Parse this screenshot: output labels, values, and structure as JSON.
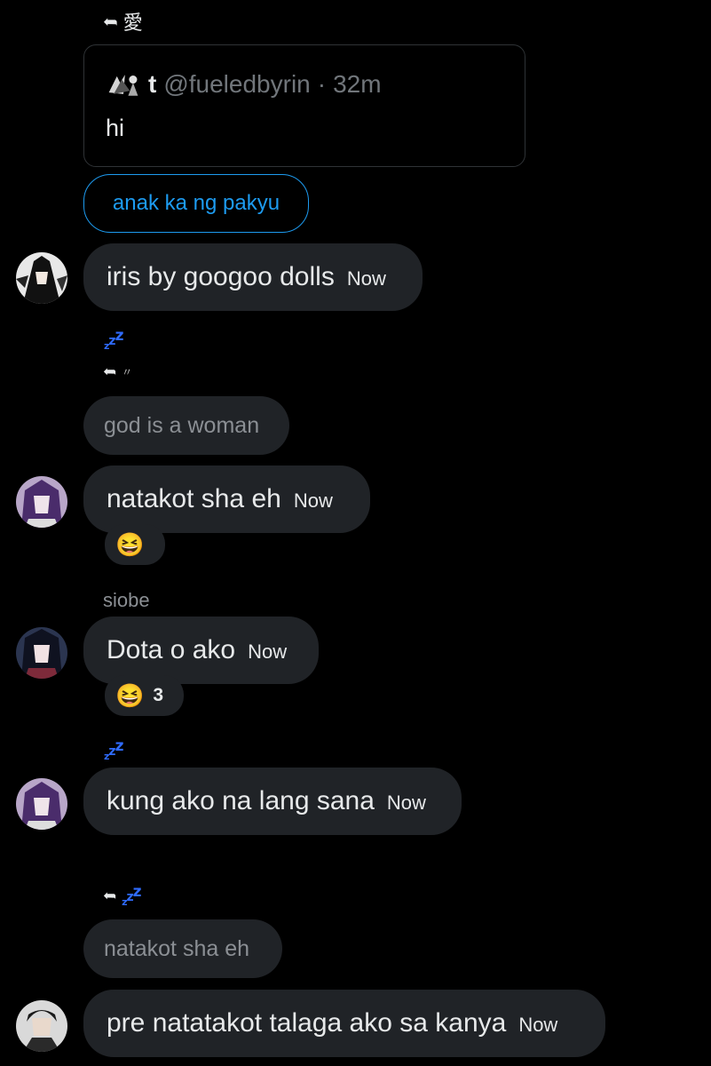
{
  "thread": {
    "top_reply_glyph": "愛",
    "quoted_tweet": {
      "name": "t",
      "handle": "@fueledbyrin",
      "time": "32m",
      "sep": "·",
      "text": "hi"
    },
    "link_pill": "anak ka ng pakyu",
    "messages": [
      {
        "text": "iris by googoo dolls",
        "time": "Now"
      },
      {
        "text": "natakot sha eh",
        "time": "Now",
        "reaction": "😆"
      },
      {
        "text": "Dota o ako",
        "time": "Now",
        "reaction": "😆",
        "reaction_count": "3"
      },
      {
        "text": "kung ako na lang sana",
        "time": "Now"
      },
      {
        "text": "pre natatakot talaga ako sa kanya",
        "time": "Now"
      }
    ],
    "replies": [
      {
        "text": "god is a woman"
      },
      {
        "text": "natakot sha eh"
      }
    ],
    "sender_label": "siobe",
    "small_reply_glyph": "〃"
  },
  "colors": {
    "background": "#000000",
    "bubble": "#202327",
    "link": "#1d9bf0",
    "zz": "#2f6bff",
    "muted": "#8b8f94"
  }
}
